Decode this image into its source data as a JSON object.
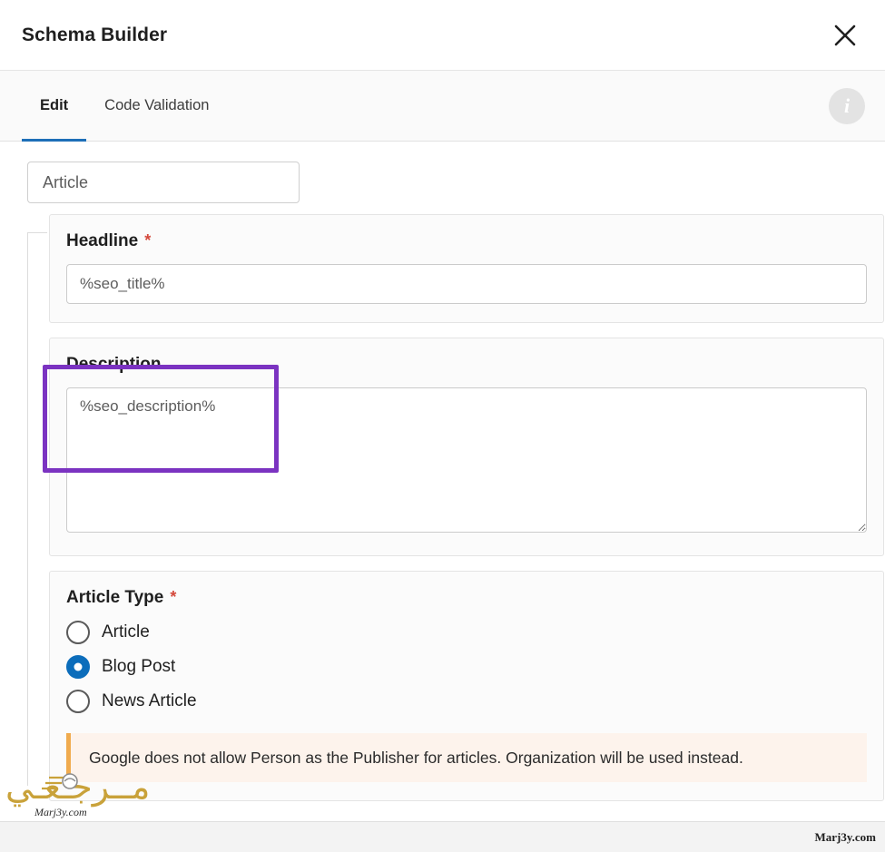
{
  "header": {
    "title": "Schema Builder",
    "close_icon": "close-icon"
  },
  "tabs": [
    {
      "label": "Edit",
      "active": true
    },
    {
      "label": "Code Validation",
      "active": false
    }
  ],
  "info_button": {
    "icon": "info-icon",
    "glyph": "i"
  },
  "schema_type": {
    "value": "",
    "placeholder": "Article"
  },
  "fields": {
    "headline": {
      "label": "Headline",
      "required": true,
      "required_marker": "*",
      "value": "",
      "placeholder": "%seo_title%",
      "highlighted": true
    },
    "description": {
      "label": "Description",
      "required": false,
      "value": "",
      "placeholder": "%seo_description%"
    },
    "article_type": {
      "label": "Article Type",
      "required": true,
      "required_marker": "*",
      "options": [
        {
          "label": "Article",
          "selected": false
        },
        {
          "label": "Blog Post",
          "selected": true
        },
        {
          "label": "News Article",
          "selected": false
        }
      ]
    }
  },
  "notice": {
    "text": "Google does not allow Person as the Publisher for articles. Organization will be used instead.",
    "accent_color": "#f0ab4e",
    "background_color": "#fdf3ec"
  },
  "colors": {
    "highlight": "#7b33c1",
    "tab_active_underline": "#1d6fb8",
    "radio_selected": "#0c6dbb",
    "required_star": "#d4493c"
  },
  "watermark": {
    "arabic": "مــرجـعـي",
    "caption": "Marj3y.com",
    "footer_url": "Marj3y.com"
  }
}
